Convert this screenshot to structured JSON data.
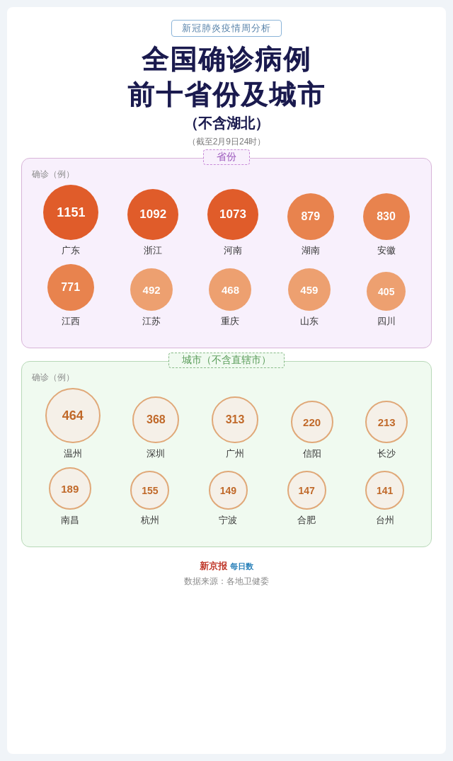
{
  "header": {
    "tag": "新冠肺炎疫情周分析",
    "title_line1": "全国确诊病例",
    "title_line2": "前十省份及城市",
    "sub_note": "（不含湖北）",
    "date_note": "（截至2月9日24时）",
    "col_label": "确诊（例）"
  },
  "province_section": {
    "label": "省份",
    "col_label": "确诊（例）",
    "row1": [
      {
        "value": "1151",
        "name": "广东",
        "size": "lg"
      },
      {
        "value": "1092",
        "name": "浙江",
        "size": "mlg"
      },
      {
        "value": "1073",
        "name": "河南",
        "size": "mlg"
      },
      {
        "value": "879",
        "name": "湖南",
        "size": "md"
      },
      {
        "value": "830",
        "name": "安徽",
        "size": "md"
      }
    ],
    "row2": [
      {
        "value": "771",
        "name": "江西",
        "size": "md"
      },
      {
        "value": "492",
        "name": "江苏",
        "size": "sm"
      },
      {
        "value": "468",
        "name": "重庆",
        "size": "sm"
      },
      {
        "value": "459",
        "name": "山东",
        "size": "sm"
      },
      {
        "value": "405",
        "name": "四川",
        "size": "xsm"
      }
    ]
  },
  "city_section": {
    "label": "城市（不含直辖市）",
    "col_label": "确诊（例）",
    "row1": [
      {
        "value": "464",
        "name": "温州",
        "size": "lg"
      },
      {
        "value": "368",
        "name": "深圳",
        "size": "md"
      },
      {
        "value": "313",
        "name": "广州",
        "size": "md"
      },
      {
        "value": "220",
        "name": "信阳",
        "size": "sm"
      },
      {
        "value": "213",
        "name": "长沙",
        "size": "sm"
      }
    ],
    "row2": [
      {
        "value": "189",
        "name": "南昌",
        "size": "sm"
      },
      {
        "value": "155",
        "name": "杭州",
        "size": "xsm"
      },
      {
        "value": "149",
        "name": "宁波",
        "size": "xsm"
      },
      {
        "value": "147",
        "name": "合肥",
        "size": "xsm"
      },
      {
        "value": "141",
        "name": "台州",
        "size": "xsm"
      }
    ]
  },
  "footer": {
    "brand": "新京报 每日数",
    "source": "数据来源：各地卫健委"
  }
}
